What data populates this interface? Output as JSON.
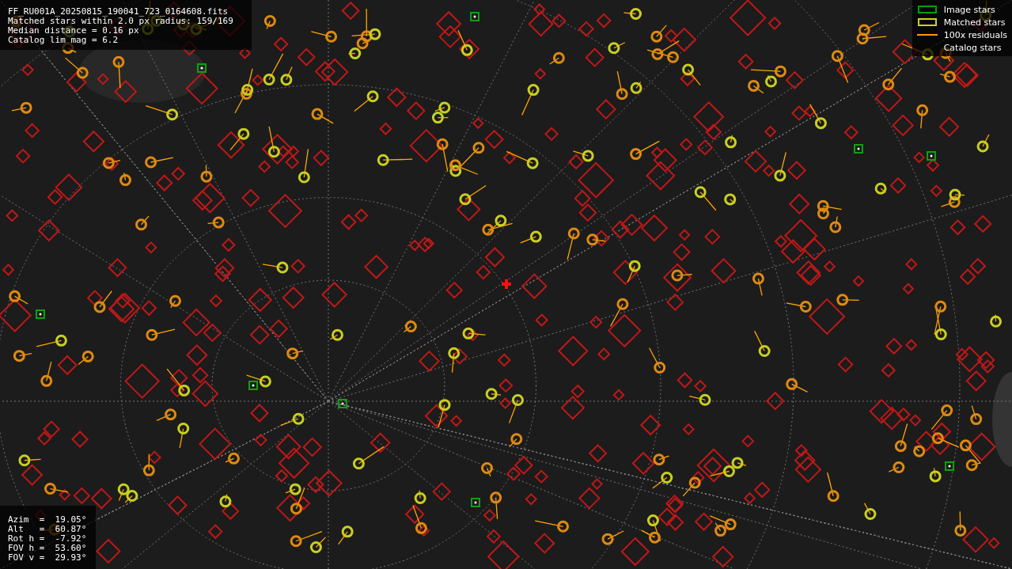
{
  "file_info": {
    "lines": [
      "FF_RU001A_20250815_190041_723_0164608.fits",
      "Matched stars within 2.0 px radius: 159/169",
      "Median distance = 0.16 px",
      "Catalog lim mag = 6.2"
    ]
  },
  "legend": {
    "items": [
      {
        "kind": "rect",
        "color": "#00a000",
        "label": "Image stars"
      },
      {
        "kind": "rect",
        "color": "#d0d020",
        "label": "Matched stars"
      },
      {
        "kind": "line",
        "color": "#ff9900",
        "label": "100x residuals"
      },
      {
        "kind": "none",
        "label": "Catalog stars"
      }
    ]
  },
  "pointing": {
    "lines": [
      "Azim  =  19.05°",
      "Alt   =  60.87°",
      "Rot h =  -7.92°",
      "FOV h =  53.60°",
      "FOV v =  29.93°"
    ]
  }
}
